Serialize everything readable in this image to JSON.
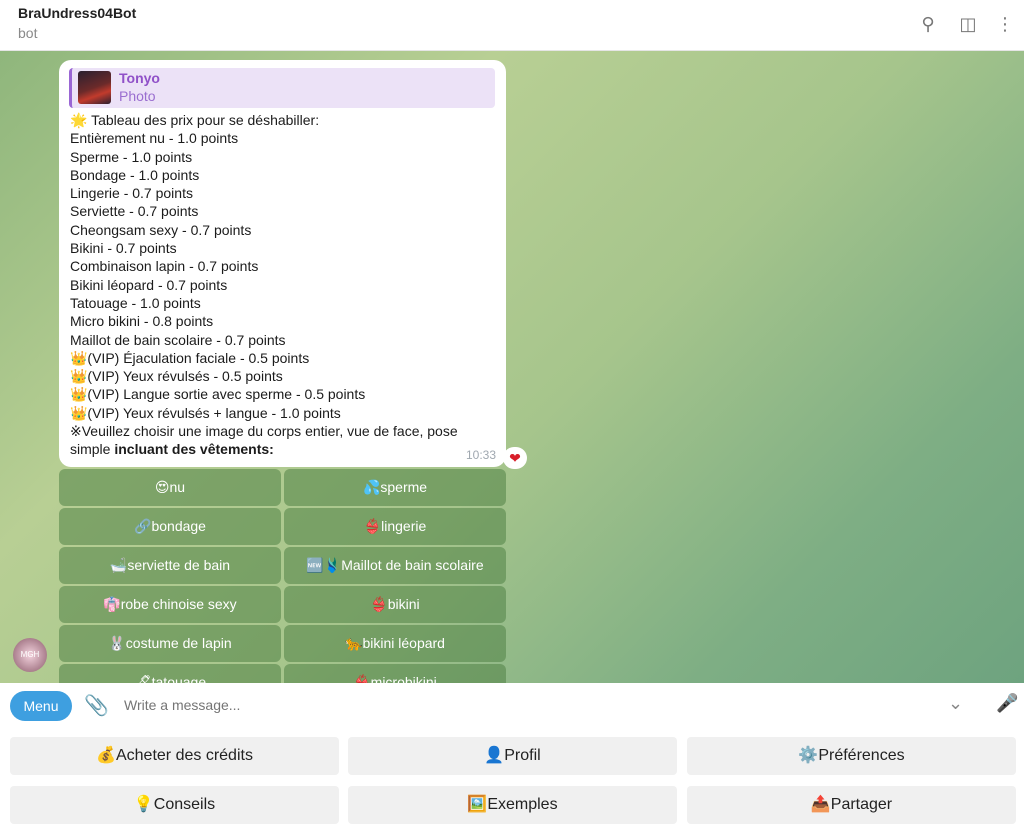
{
  "header": {
    "title": "BraUndress04Bot",
    "subtitle": "bot",
    "icons": [
      "search-icon",
      "sidebar-icon",
      "more-icon"
    ]
  },
  "message": {
    "reply": {
      "name": "Tonyo",
      "type": "Photo"
    },
    "lines": [
      "🌟 Tableau des prix pour se déshabiller:",
      "Entièrement nu - 1.0 points",
      "Sperme - 1.0 points",
      "Bondage - 1.0 points",
      "Lingerie - 0.7 points",
      "Serviette - 0.7 points",
      "Cheongsam sexy - 0.7 points",
      "Bikini - 0.7 points",
      "Combinaison lapin - 0.7 points",
      "Bikini léopard - 0.7 points",
      "Tatouage - 1.0 points",
      "Micro bikini - 0.8 points",
      "Maillot de bain scolaire - 0.7 points",
      "👑(VIP) Éjaculation faciale - 0.5 points",
      "👑(VIP) Yeux révulsés - 0.5 points",
      "👑(VIP) Langue sortie avec sperme - 0.5 points",
      "👑(VIP) Yeux révulsés + langue - 1.0 points",
      "※Veuillez choisir une image du corps entier, vue de face, pose"
    ],
    "last_plain": "simple ",
    "last_bold": "incluant des vêtements:",
    "time": "10:33",
    "reaction": "❤"
  },
  "inline_keyboard": [
    "😍nu",
    "💦sperme",
    "🔗bondage",
    "👙lingerie",
    "🛁serviette de bain",
    "🆕🩱Maillot de bain scolaire",
    "👘robe chinoise sexy",
    "👙bikini",
    "🐰costume de lapin",
    "🐆bikini léopard",
    "🖊tatouage",
    "👙microbikini"
  ],
  "avatar": "MGH Backup",
  "input": {
    "menu": "Menu",
    "placeholder": "Write a message..."
  },
  "reply_keyboard": [
    "💰Acheter des crédits",
    "👤Profil",
    "⚙️Préférences",
    "💡Conseils",
    "🖼️Exemples",
    "📤Partager"
  ]
}
